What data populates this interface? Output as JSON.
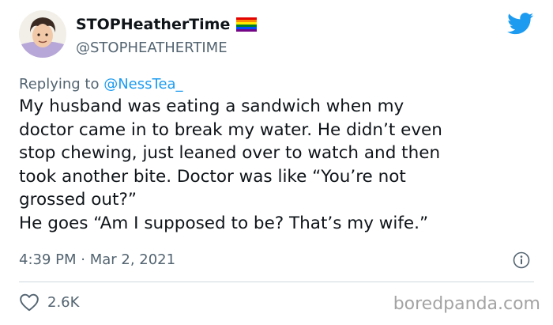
{
  "author": {
    "display_name": "STOPHeatherTime",
    "handle": "@STOPHEATHERTIME",
    "avatar_icon": "avatar-illustration",
    "badge_icon": "rainbow-flag-icon"
  },
  "reply": {
    "prefix": "Replying to",
    "mention": "@NessTea_"
  },
  "tweet": {
    "lines": [
      "My husband was eating a sandwich when my",
      "doctor came in to break my water. He didn’t even",
      "stop chewing, just leaned over to watch and then",
      "took another bite. Doctor was like “You’re not",
      "grossed out?”",
      "He goes “Am I supposed to be? That’s my wife.”"
    ],
    "timestamp": "4:39 PM · Mar 2, 2021"
  },
  "engagement": {
    "like_icon": "heart-icon",
    "like_count": "2.6K"
  },
  "watermark": "boredpanda.com",
  "colors": {
    "twitter_blue": "#1d9bf0",
    "text": "#0f1419",
    "muted": "#536471",
    "divider": "#cfd9de"
  }
}
